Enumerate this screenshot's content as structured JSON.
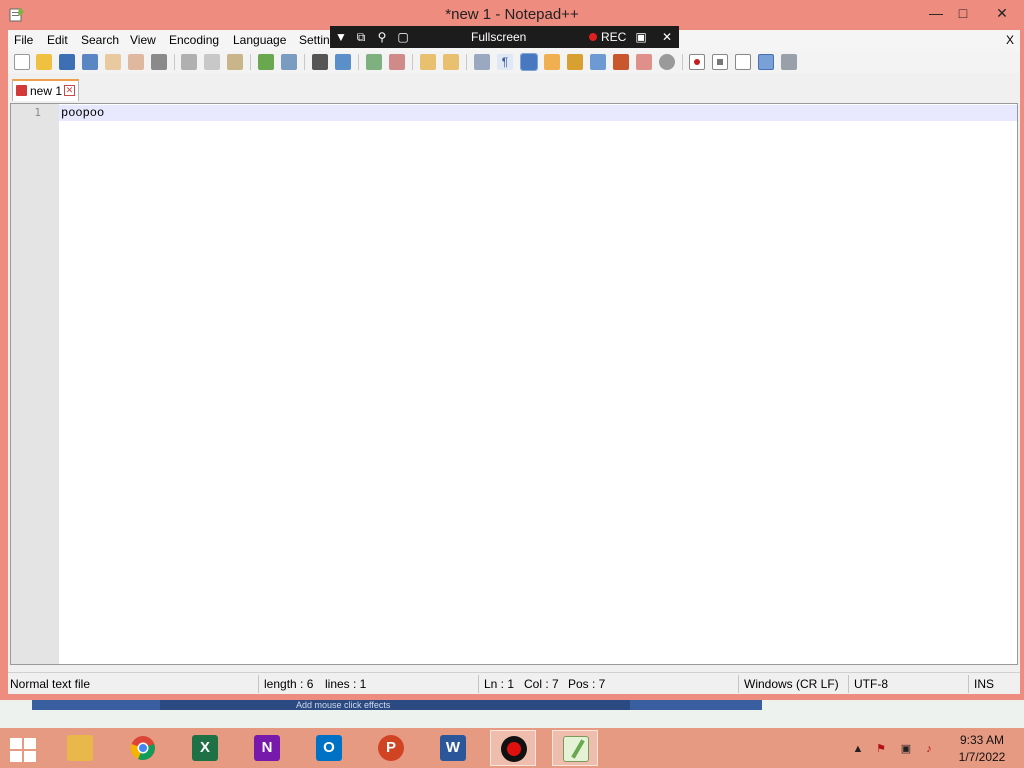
{
  "window": {
    "title": "*new 1 - Notepad++"
  },
  "menu": {
    "items": [
      "File",
      "Edit",
      "Search",
      "View",
      "Encoding",
      "Language",
      "Settin"
    ],
    "close": "X"
  },
  "toolbar": {
    "icons": [
      "new-file-icon",
      "open-file-icon",
      "save-icon",
      "save-all-icon",
      "close-icon",
      "close-all-icon",
      "print-icon",
      "cut-icon",
      "copy-icon",
      "paste-icon",
      "undo-icon",
      "redo-icon",
      "find-icon",
      "replace-icon",
      "zoom-in-icon",
      "zoom-out-icon",
      "sync-vertical-icon",
      "sync-horizontal-icon",
      "word-wrap-icon",
      "show-all-chars-icon",
      "indent-guide-icon",
      "user-language-icon",
      "function-list-icon",
      "document-map-icon",
      "folder-workspace-icon",
      "document-list-icon",
      "monitoring-icon",
      "record-macro-icon",
      "stop-macro-icon",
      "play-macro-icon",
      "run-macro-multiple-icon",
      "save-macro-icon"
    ]
  },
  "tab": {
    "label": "new 1"
  },
  "editor": {
    "line_number": "1",
    "text": "poopoo"
  },
  "status": {
    "file_type": "Normal text file",
    "length": "length : 6",
    "lines": "lines : 1",
    "ln": "Ln : 1",
    "col": "Col : 7",
    "pos": "Pos : 7",
    "eol": "Windows (CR LF)",
    "encoding": "UTF-8",
    "mode": "INS"
  },
  "recorder": {
    "fullscreen": "Fullscreen",
    "rec": "REC"
  },
  "background": {
    "text": "Add mouse click effects"
  },
  "taskbar": {
    "apps": [
      "File Explorer",
      "Google Chrome",
      "Excel",
      "OneNote",
      "Outlook",
      "PowerPoint",
      "Word",
      "Screen Recorder",
      "Notepad++"
    ],
    "time": "9:33 AM",
    "date": "1/7/2022"
  },
  "colors": {
    "frame": "#ef8c80",
    "taskbar": "#e79a82",
    "current_line": "#e8e8ff",
    "rec": "#e02020"
  }
}
